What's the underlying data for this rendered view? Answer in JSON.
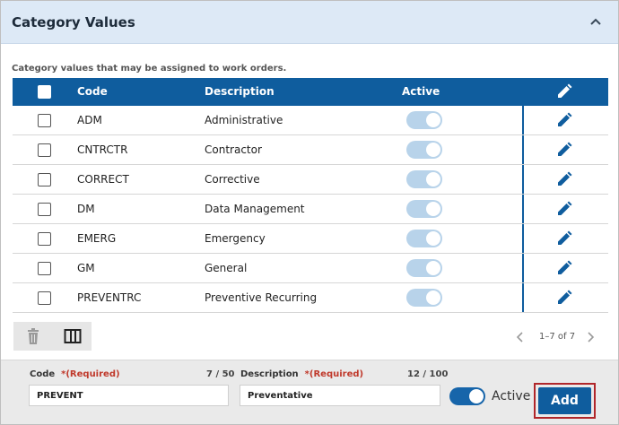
{
  "panel": {
    "title": "Category Values",
    "hint": "Category values that may be assigned to work orders."
  },
  "table": {
    "columns": {
      "code": "Code",
      "description": "Description",
      "active": "Active"
    },
    "rows": [
      {
        "code": "ADM",
        "description": "Administrative",
        "active": true
      },
      {
        "code": "CNTRCTR",
        "description": "Contractor",
        "active": true
      },
      {
        "code": "CORRECT",
        "description": "Corrective",
        "active": true
      },
      {
        "code": "DM",
        "description": "Data Management",
        "active": true
      },
      {
        "code": "EMERG",
        "description": "Emergency",
        "active": true
      },
      {
        "code": "GM",
        "description": "General",
        "active": true
      },
      {
        "code": "PREVENTRC",
        "description": "Preventive Recurring",
        "active": true
      }
    ]
  },
  "pager": {
    "info": "1–7 of 7"
  },
  "form": {
    "code_label": "Code",
    "code_required": "*(Required)",
    "code_count": "7 / 50",
    "code_value": "PREVENT",
    "desc_label": "Description",
    "desc_required": "*(Required)",
    "desc_count": "12 / 100",
    "desc_value": "Preventative",
    "active_label": "Active",
    "active_on": true,
    "add_label": "Add"
  },
  "icons": {
    "collapse": "chevron-up-icon",
    "edit": "pencil-icon",
    "delete": "trash-icon",
    "columns": "columns-icon",
    "prev": "chevron-left-icon",
    "next": "chevron-right-icon"
  },
  "colors": {
    "header_bg": "#dde9f6",
    "table_header": "#0f5d9e",
    "toggle_disabled": "#b8d3ea",
    "toggle_on": "#1765aa",
    "required": "#c0392b",
    "highlight_border": "#b0262a"
  }
}
